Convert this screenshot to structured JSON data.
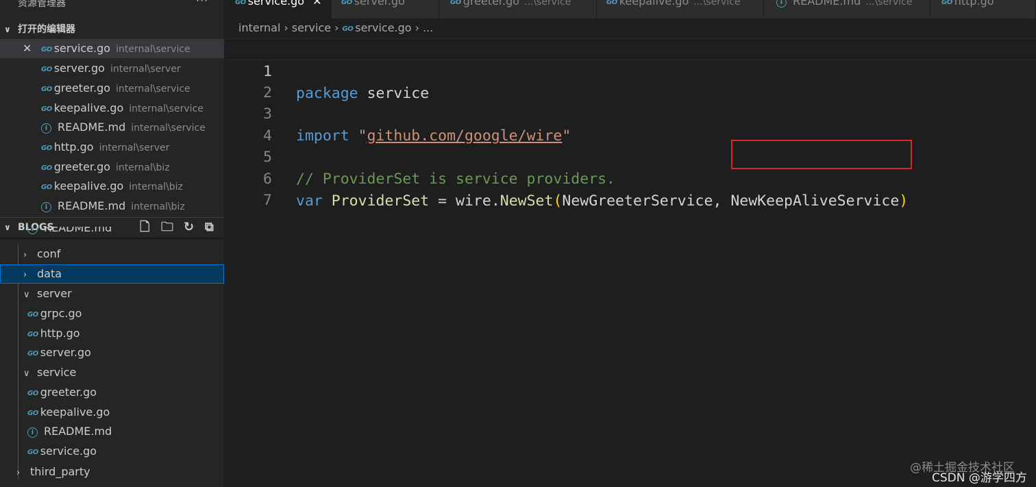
{
  "sidebar": {
    "title": "资源管理器",
    "more": "···",
    "open_editors": {
      "header": "打开的编辑器",
      "items": [
        {
          "name": "service.go",
          "dir": "internal\\service",
          "icon": "go-file-icon"
        },
        {
          "name": "server.go",
          "dir": "internal\\server",
          "icon": "go-file-icon"
        },
        {
          "name": "greeter.go",
          "dir": "internal\\service",
          "icon": "go-file-icon"
        },
        {
          "name": "keepalive.go",
          "dir": "internal\\service",
          "icon": "go-file-icon"
        },
        {
          "name": "README.md",
          "dir": "internal\\service",
          "icon": "info-icon"
        },
        {
          "name": "http.go",
          "dir": "internal\\server",
          "icon": "go-file-icon"
        },
        {
          "name": "greeter.go",
          "dir": "internal\\biz",
          "icon": "go-file-icon"
        },
        {
          "name": "keepalive.go",
          "dir": "internal\\biz",
          "icon": "go-file-icon"
        },
        {
          "name": "README.md",
          "dir": "internal\\biz",
          "icon": "info-icon"
        }
      ]
    },
    "blogs": {
      "header": "BLOGS",
      "partial_item": "README.md",
      "tree": [
        {
          "label": "conf",
          "type": "folder",
          "expanded": false
        },
        {
          "label": "data",
          "type": "folder",
          "expanded": false
        },
        {
          "label": "server",
          "type": "folder",
          "expanded": true
        },
        {
          "label": "grpc.go",
          "type": "go"
        },
        {
          "label": "http.go",
          "type": "go"
        },
        {
          "label": "server.go",
          "type": "go"
        },
        {
          "label": "service",
          "type": "folder",
          "expanded": true
        },
        {
          "label": "greeter.go",
          "type": "go"
        },
        {
          "label": "keepalive.go",
          "type": "go"
        },
        {
          "label": "README.md",
          "type": "md"
        },
        {
          "label": "service.go",
          "type": "go"
        },
        {
          "label": "third_party",
          "type": "folder",
          "expanded": false
        }
      ]
    }
  },
  "tabs": [
    {
      "name": "service.go",
      "dir": "",
      "active": true,
      "icon": "go-file-icon"
    },
    {
      "name": "server.go",
      "dir": "",
      "active": false,
      "icon": "go-file-icon"
    },
    {
      "name": "greeter.go",
      "dir": "...\\service",
      "active": false,
      "icon": "go-file-icon"
    },
    {
      "name": "keepalive.go",
      "dir": "...\\service",
      "active": false,
      "icon": "go-file-icon"
    },
    {
      "name": "README.md",
      "dir": "...\\service",
      "active": false,
      "icon": "info-icon"
    },
    {
      "name": "http.go",
      "dir": "",
      "active": false,
      "icon": "go-file-icon"
    }
  ],
  "breadcrumb": {
    "parts": [
      "internal",
      "service",
      "service.go",
      "..."
    ]
  },
  "code": {
    "line_numbers": [
      "1",
      "2",
      "3",
      "4",
      "5",
      "6",
      "7"
    ],
    "l1_kw": "package",
    "l1_name": "service",
    "l3_kw": "import",
    "l3_q1": "\"",
    "l3_path": "github.com/google/wire",
    "l3_q2": "\"",
    "l5_comment": "// ProviderSet is service providers.",
    "l6_kw": "var",
    "l6_var": "ProviderSet",
    "l6_eq": " = ",
    "l6_pkg": "wire",
    "l6_dot": ".",
    "l6_fn": "NewSet",
    "l6_open": "(",
    "l6_arg1": "NewGreeterService",
    "l6_comma": ", ",
    "l6_arg2": "NewKeepAliveService",
    "l6_close": ")"
  },
  "watermark": {
    "line1": "@稀土掘金技术社区",
    "line2": "CSDN @游学四方"
  },
  "colors": {
    "highlight_box": "#e0252b",
    "keyword": "#569cd6",
    "string": "#ce9178",
    "comment": "#6a9955",
    "function": "#dcdcaa"
  }
}
